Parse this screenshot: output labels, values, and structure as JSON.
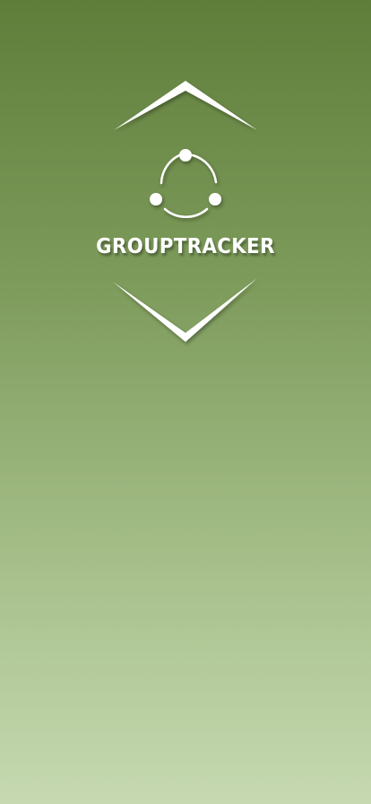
{
  "app": {
    "name": "GROUPTRACKER"
  },
  "logo": {
    "icon": "group-network-icon",
    "chevron_up_icon": "chevron-up-icon",
    "chevron_down_icon": "chevron-down-icon"
  },
  "colors": {
    "background_top": "#5f7e3a",
    "background_bottom": "#c6d9b1",
    "foreground": "#ffffff"
  }
}
